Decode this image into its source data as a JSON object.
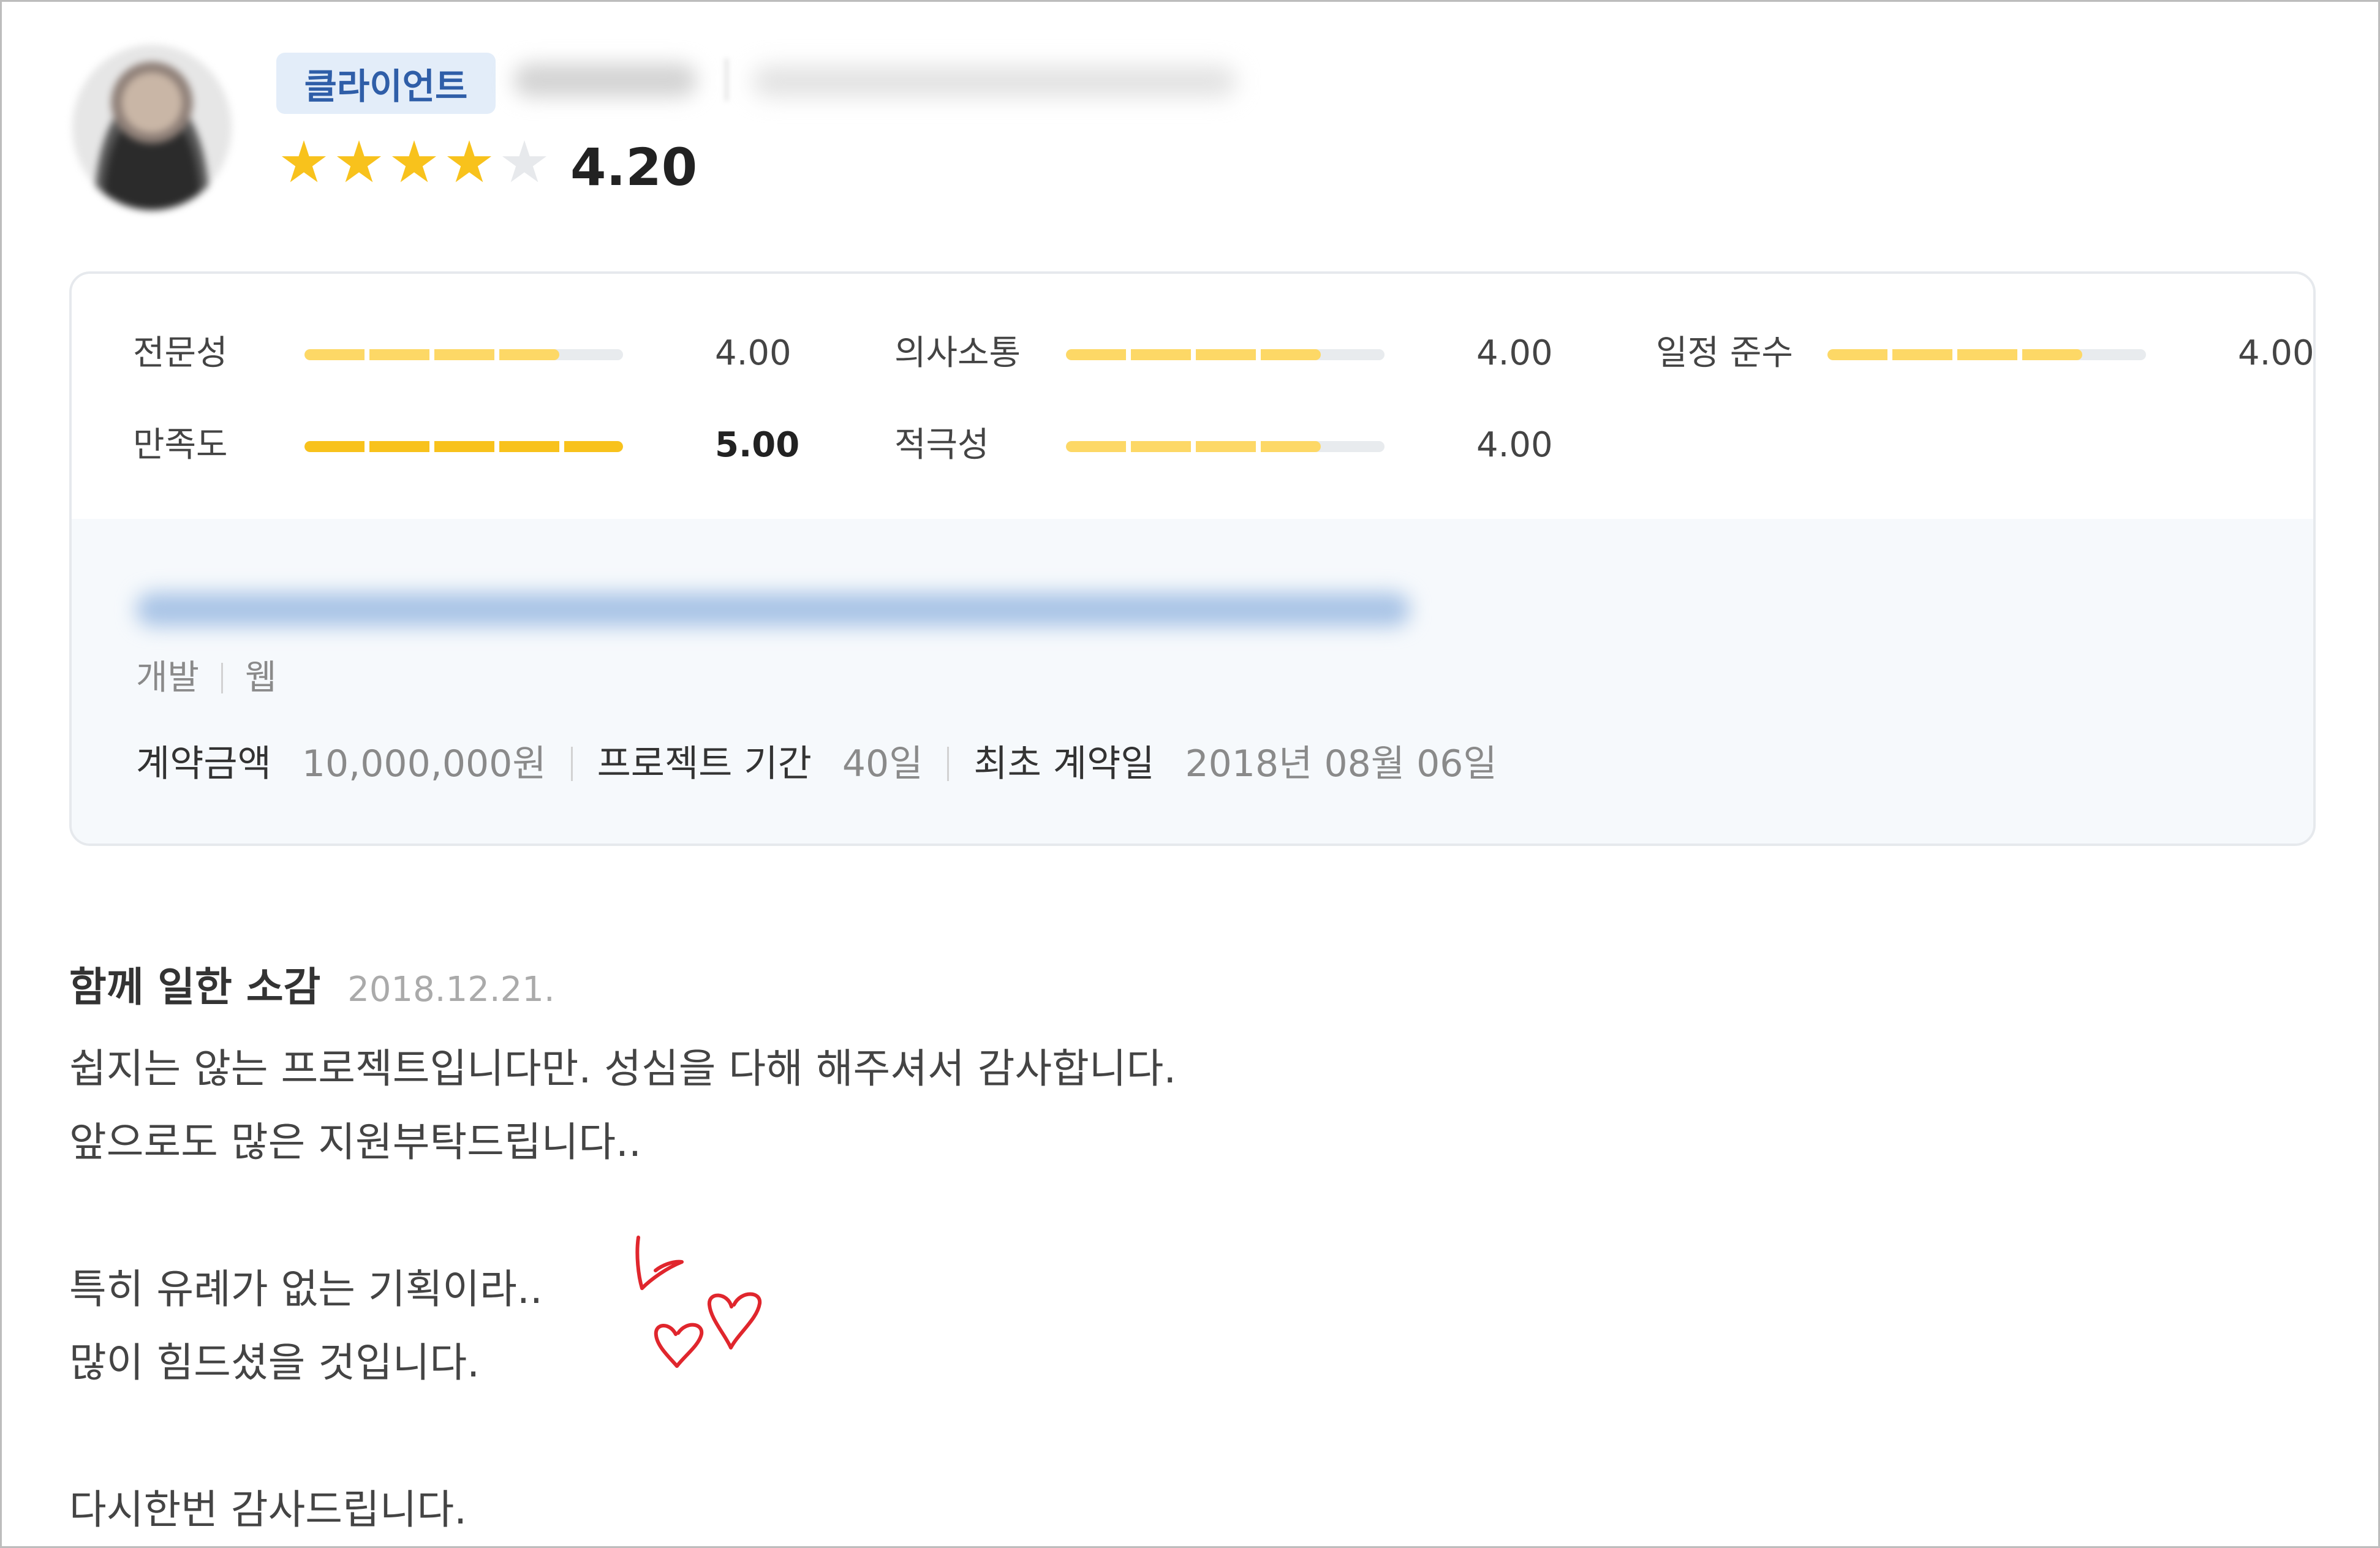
{
  "header": {
    "avatar_icon": "avatar-photo-blurred",
    "badge": "클라이언트",
    "rating": {
      "stars_filled": 4,
      "stars_total": 5,
      "stars": [
        "★",
        "★",
        "★",
        "★",
        "★"
      ],
      "score": "4.20",
      "star_color": "#f8c21c"
    }
  },
  "metrics": [
    {
      "label": "전문성",
      "value": "4.00",
      "fraction": 0.8
    },
    {
      "label": "의사소통",
      "value": "4.00",
      "fraction": 0.8
    },
    {
      "label": "일정 준수",
      "value": "4.00",
      "fraction": 0.8
    },
    {
      "label": "만족도",
      "value": "5.00",
      "fraction": 1.0
    },
    {
      "label": "적극성",
      "value": "4.00",
      "fraction": 0.8
    }
  ],
  "project": {
    "tags": [
      "개발",
      "웹"
    ],
    "contract": {
      "amount_label": "계약금액",
      "amount_value": "10,000,000원",
      "period_label": "프로젝트 기간",
      "period_value": "40일",
      "date_label": "최초 계약일",
      "date_value": "2018년 08월 06일"
    }
  },
  "review": {
    "title": "함께 일한 소감",
    "date": "2018.12.21.",
    "lines": [
      "쉽지는 않는 프로젝트입니다만. 성심을 다해 해주셔서 감사합니다.",
      "앞으로도 많은 지원부탁드립니다..",
      "특히 유례가 없는 기획이라..",
      "많이 힘드셨을 것입니다.",
      "다시한번 감사드립니다."
    ],
    "doodle_icon": "heart-doodle-icon",
    "doodle_color": "#e0262d"
  }
}
